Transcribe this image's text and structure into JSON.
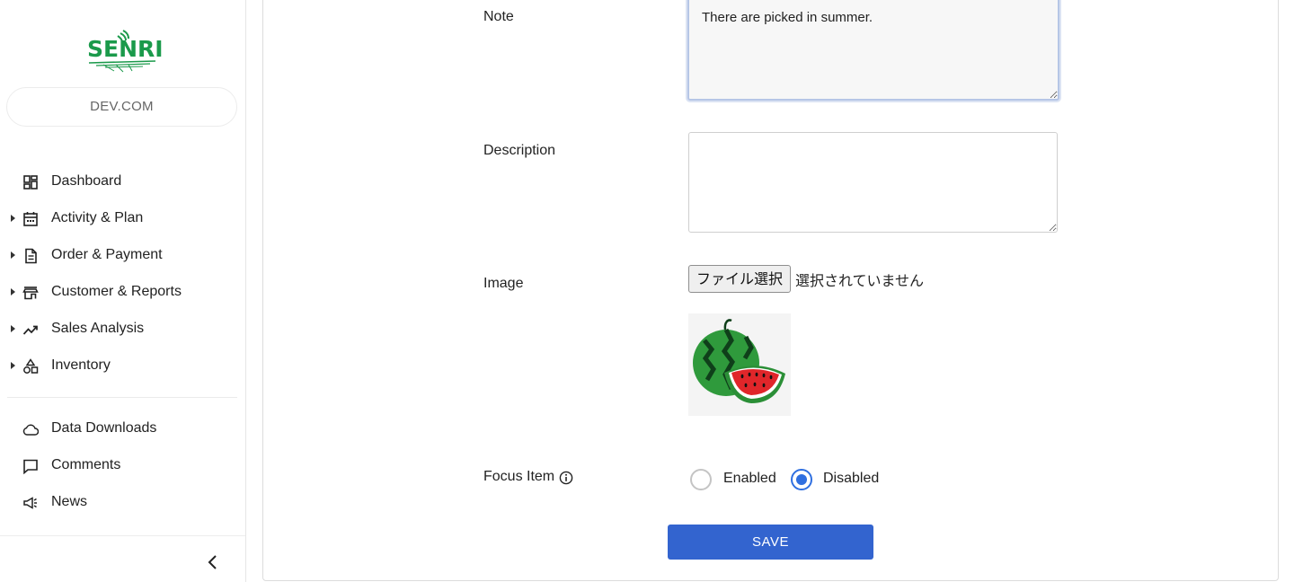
{
  "brand": {
    "logo_text": "SENRI",
    "org": "DEV.COM",
    "accent": "#1b9a4b"
  },
  "sidebar": {
    "items": [
      {
        "label": "Dashboard",
        "icon": "dashboard-icon",
        "expandable": false
      },
      {
        "label": "Activity & Plan",
        "icon": "calendar-icon",
        "expandable": true
      },
      {
        "label": "Order & Payment",
        "icon": "document-icon",
        "expandable": true
      },
      {
        "label": "Customer & Reports",
        "icon": "store-icon",
        "expandable": true
      },
      {
        "label": "Sales Analysis",
        "icon": "trending-up-icon",
        "expandable": true
      },
      {
        "label": "Inventory",
        "icon": "shapes-icon",
        "expandable": true
      },
      {
        "label": "Data Downloads",
        "icon": "cloud-icon",
        "expandable": false
      },
      {
        "label": "Comments",
        "icon": "comment-icon",
        "expandable": false
      },
      {
        "label": "News",
        "icon": "megaphone-icon",
        "expandable": false
      }
    ]
  },
  "form": {
    "note": {
      "label": "Note",
      "value": "There are picked in summer."
    },
    "description": {
      "label": "Description",
      "value": ""
    },
    "image": {
      "label": "Image",
      "button": "ファイル選択",
      "status": "選択されていません",
      "thumbnail": "watermelon-image"
    },
    "focus_item": {
      "label": "Focus Item",
      "options": [
        "Enabled",
        "Disabled"
      ],
      "selected": "Disabled"
    },
    "save_label": "SAVE"
  },
  "colors": {
    "primary": "#3364cf",
    "radio_selected": "#2f6fe0"
  }
}
